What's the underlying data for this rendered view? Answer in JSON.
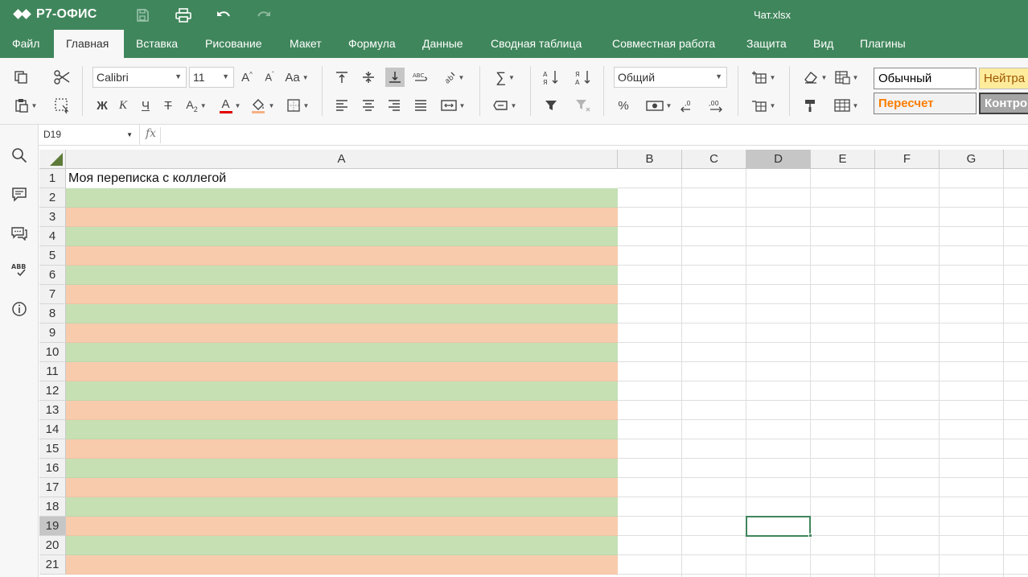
{
  "app": {
    "logo": "Р7-ОФИС",
    "document_title": "Чат.xlsx"
  },
  "colors": {
    "brand": "#40865c",
    "row_green": "#c6e0b4",
    "row_orange": "#f8cbad",
    "style_neutral": "#ffeb9c",
    "style_calc_text": "#fa7d00"
  },
  "quick_access": [
    {
      "name": "save-icon"
    },
    {
      "name": "print-icon"
    },
    {
      "name": "undo-icon"
    },
    {
      "name": "redo-icon"
    }
  ],
  "menu": {
    "tabs": [
      {
        "label": "Файл",
        "active": false
      },
      {
        "label": "Главная",
        "active": true
      },
      {
        "label": "Вставка",
        "active": false
      },
      {
        "label": "Рисование",
        "active": false
      },
      {
        "label": "Макет",
        "active": false
      },
      {
        "label": "Формула",
        "active": false
      },
      {
        "label": "Данные",
        "active": false
      },
      {
        "label": "Сводная таблица",
        "active": false
      },
      {
        "label": "Совместная работа",
        "active": false
      },
      {
        "label": "Защита",
        "active": false
      },
      {
        "label": "Вид",
        "active": false
      },
      {
        "label": "Плагины",
        "active": false
      }
    ]
  },
  "toolbar": {
    "font_name": "Calibri",
    "font_size": "11",
    "bold": "Ж",
    "italic": "К",
    "underline": "Ч",
    "strike": "Т",
    "number_format": "Общий",
    "percent": "%",
    "cell_styles": [
      {
        "label": "Обычный"
      },
      {
        "label": "Нейтра"
      },
      {
        "label": "Пересчет"
      },
      {
        "label": "Контро"
      }
    ]
  },
  "formula_bar": {
    "cell_ref": "D19",
    "fx": "fx",
    "content": ""
  },
  "sheet": {
    "columns": [
      "A",
      "B",
      "C",
      "D",
      "E",
      "F",
      "G"
    ],
    "selected_column": "D",
    "selected_row": "19",
    "rows": [
      "1",
      "2",
      "3",
      "4",
      "5",
      "6",
      "7",
      "8",
      "9",
      "10",
      "11",
      "12",
      "13",
      "14",
      "15",
      "16",
      "17",
      "18",
      "19",
      "20",
      "21"
    ],
    "cell_A1": "Моя переписка с коллегой"
  },
  "sidebar": [
    {
      "name": "search-icon"
    },
    {
      "name": "comments-icon"
    },
    {
      "name": "chat-icon"
    },
    {
      "name": "spellcheck-icon"
    },
    {
      "name": "info-icon"
    }
  ]
}
